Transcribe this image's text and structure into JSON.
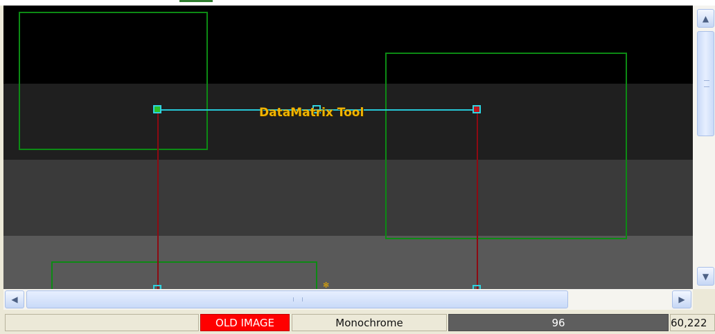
{
  "viewer": {
    "tool_label": "DataMatrix Tool",
    "image_bands": [
      "#000000",
      "#1f1f1f",
      "#3a3a3a",
      "#595959"
    ]
  },
  "status": {
    "blank": "",
    "image_state": "OLD IMAGE",
    "color_mode": "Monochrome",
    "pixel_value": "96",
    "coordinates": "60,222"
  },
  "scrollbars": {
    "up_icon": "arrow-up-icon",
    "down_icon": "arrow-down-icon",
    "left_icon": "arrow-left-icon",
    "right_icon": "arrow-right-icon"
  },
  "colors": {
    "roi": "#0c8a14",
    "link_line": "#27c8d7",
    "vertical_line": "#8d0a12",
    "label": "#f2b400",
    "status_alert": "#ff0000"
  }
}
